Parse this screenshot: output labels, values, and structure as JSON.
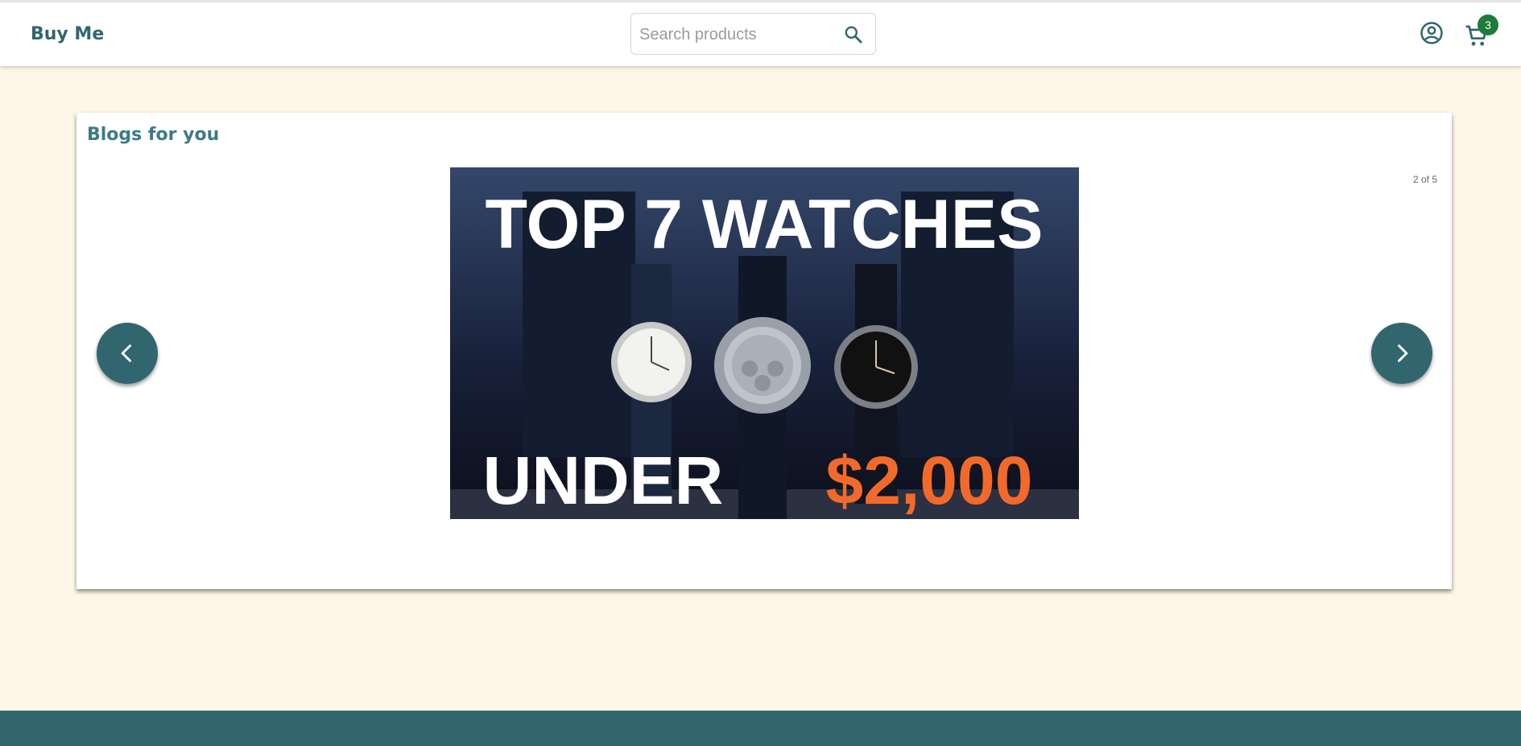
{
  "header": {
    "brand": "Buy Me",
    "search": {
      "placeholder": "Search products",
      "value": ""
    },
    "icons": {
      "search": "search-icon",
      "account": "account-circle-icon",
      "cart": "shopping-cart-icon"
    },
    "cart_count": "3"
  },
  "blogs": {
    "title": "Blogs for you",
    "counter": "2 of 5",
    "current_slide": 2,
    "total_slides": 5,
    "slide": {
      "headline_top": "TOP 7 WATCHES",
      "headline_bottom_left": "UNDER",
      "headline_bottom_right": "$2,000"
    },
    "prev_icon": "chevron-left-icon",
    "next_icon": "chevron-right-icon"
  },
  "colors": {
    "brand": "#31666f",
    "page_bg": "#fef6e6",
    "badge": "#1e7b3b",
    "price_accent": "#f26a2b"
  }
}
